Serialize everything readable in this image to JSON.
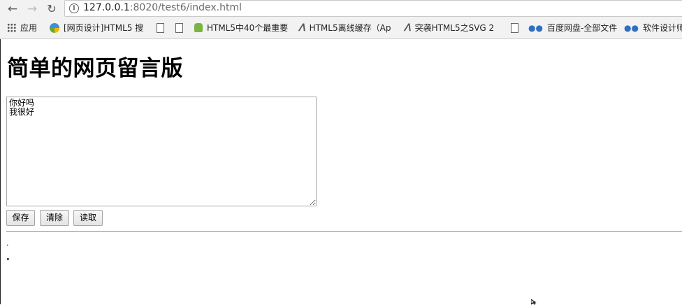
{
  "browser": {
    "url_host": "127.0.0.1",
    "url_rest": ":8020/test6/index.html",
    "bookmarks": [
      {
        "label": "应用",
        "icon": "apps-grid-icon"
      },
      {
        "label": "[网页设计]HTML5 搜",
        "icon": "colorful-ball-icon"
      },
      {
        "label": "",
        "icon": "document-icon"
      },
      {
        "label": "",
        "icon": "document-icon"
      },
      {
        "label": "HTML5中40个最重要",
        "icon": "android-icon"
      },
      {
        "label": "HTML5离线缓存（Ap",
        "icon": "svg-logo-icon"
      },
      {
        "label": "突袭HTML5之SVG 2",
        "icon": "svg-logo-icon"
      },
      {
        "label": "",
        "icon": "document-icon"
      },
      {
        "label": "百度网盘-全部文件",
        "icon": "baidu-cloud-icon"
      },
      {
        "label": "软件设计师",
        "icon": "baidu-cloud-icon"
      }
    ]
  },
  "page": {
    "title": "简单的网页留言版",
    "textarea_value": "你好吗\n我很好",
    "buttons": {
      "save": "保存",
      "clear": "清除",
      "read": "读取"
    },
    "output_line1": ".",
    "output_line2": "\""
  }
}
